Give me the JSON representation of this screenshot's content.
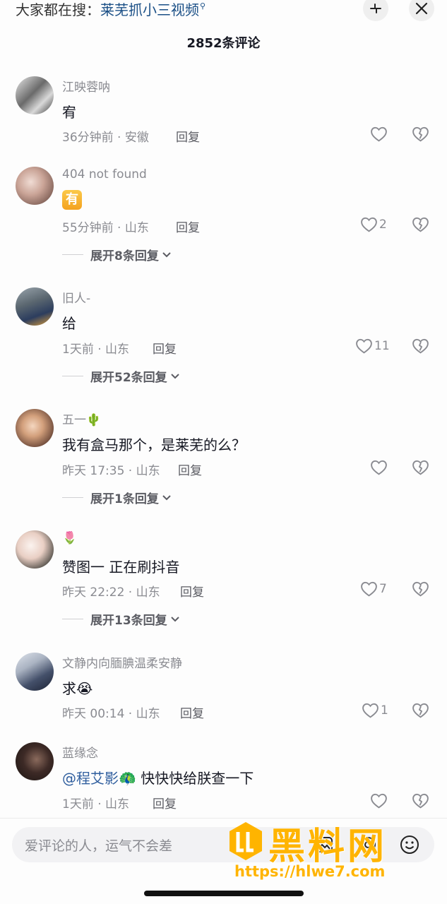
{
  "header": {
    "search_prefix": "大家都在搜：",
    "search_link": "莱芜抓小三视频",
    "count_title": "2852条评论"
  },
  "comments": [
    {
      "user": "江映蓉呐",
      "text": "宥",
      "meta": "36分钟前 · 安徽",
      "reply": "回复",
      "likes": ""
    },
    {
      "user": "404 not found",
      "text_badge": "有",
      "meta": "55分钟前 · 山东",
      "reply": "回复",
      "likes": "2",
      "expand": "展开8条回复"
    },
    {
      "user": "旧人-",
      "text": "给",
      "meta": "1天前 · 山东",
      "reply": "回复",
      "likes": "11",
      "expand": "展开52条回复"
    },
    {
      "user": "五一🌵",
      "text": "我有盒马那个，是莱芜的么？",
      "meta": "昨天 17:35 · 山东",
      "reply": "回复",
      "likes": "",
      "expand": "展开1条回复"
    },
    {
      "user": "🌷",
      "text": "赞图一  正在刷抖音",
      "meta": "昨天 22:22 · 山东",
      "reply": "回复",
      "likes": "7",
      "expand": "展开13条回复"
    },
    {
      "user": "文静内向腼腆温柔安静",
      "text": "求😭",
      "meta": "昨天 00:14 · 山东",
      "reply": "回复",
      "likes": "1"
    },
    {
      "user": "蓝缘念",
      "mention": "@程艾影🦚",
      "text": " 快快快给朕查一下",
      "meta": "1天前 · 山东",
      "reply": "回复",
      "likes": ""
    }
  ],
  "composer": {
    "placeholder": "爱评论的人，运气不会差"
  },
  "watermark": {
    "title": "黑料网",
    "url": "https://hlwe7.com"
  },
  "colors": {
    "accent_link": "#1a4f86",
    "mention": "#2f5e9e",
    "watermark": "#ffb400"
  }
}
